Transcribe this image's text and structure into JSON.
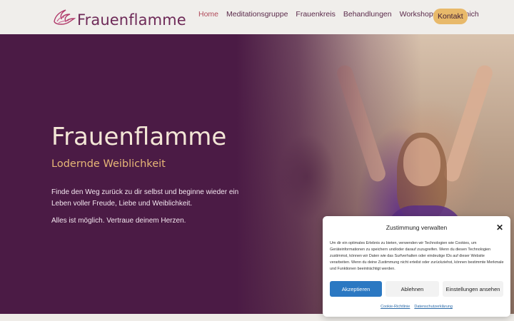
{
  "header": {
    "logo_text": "Frauenflamme",
    "nav": [
      {
        "label": "Home",
        "active": true
      },
      {
        "label": "Meditationsgruppe",
        "active": false
      },
      {
        "label": "Frauenkreis",
        "active": false
      },
      {
        "label": "Behandlungen",
        "active": false
      },
      {
        "label": "Workshops",
        "active": false
      },
      {
        "label": "Über mich",
        "active": false
      }
    ],
    "cta_label": "Kontakt"
  },
  "hero": {
    "title": "Frauenflamme",
    "subtitle": "Lodernde Weiblichkeit",
    "paragraph": "Finde den Weg zurück zu dir selbst und beginne wieder ein Leben voller Freude, Liebe und Weiblichkeit.",
    "paragraph2": "Alles ist möglich. Vertraue deinem Herzen."
  },
  "consent": {
    "title": "Zustimmung verwalten",
    "close_icon": "close-icon",
    "text": "Um dir ein optimales Erlebnis zu bieten, verwenden wir Technologien wie Cookies, um Geräteinformationen zu speichern und/oder darauf zuzugreifen. Wenn du diesen Technologien zustimmst, können wir Daten wie das Surfverhalten oder eindeutige IDs auf dieser Website verarbeiten. Wenn du deine Zustimmung nicht erteilst oder zurückziehst, können bestimmte Merkmale und Funktionen beeinträchtigt werden.",
    "accept_label": "Akzeptieren",
    "deny_label": "Ablehnen",
    "settings_label": "Einstellungen ansehen",
    "link_cookie": "Cookie-Richtlinie",
    "link_privacy": "Datenschutzerklärung"
  },
  "colors": {
    "brand": "#6e2a58",
    "hero_bg": "#4b1b45",
    "accent": "#e8b96a",
    "button_blue": "#2b78c2"
  }
}
